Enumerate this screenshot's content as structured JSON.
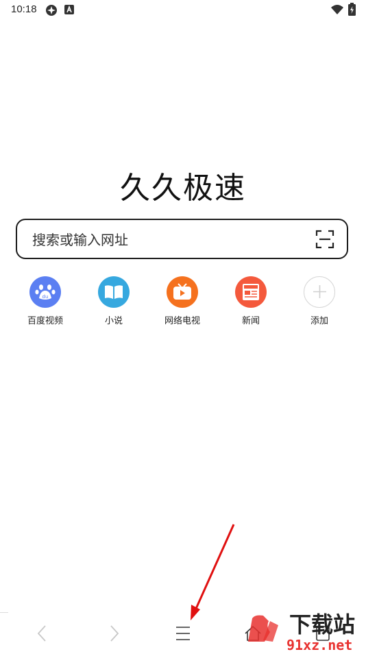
{
  "status_bar": {
    "time": "10:18"
  },
  "app": {
    "title": "久久极速"
  },
  "search": {
    "placeholder": "搜索或输入网址"
  },
  "shortcuts": [
    {
      "label": "百度视频",
      "icon": "baidu-paw-icon",
      "color": "#5b7ff2"
    },
    {
      "label": "小说",
      "icon": "book-icon",
      "color": "#36a8df"
    },
    {
      "label": "网络电视",
      "icon": "tv-icon",
      "color": "#f5711e"
    },
    {
      "label": "新闻",
      "icon": "news-icon",
      "color": "#f4593c"
    },
    {
      "label": "添加",
      "icon": "plus-icon",
      "color": "#cccccc"
    }
  ],
  "watermark": {
    "brand": "下载站",
    "site": "91xz.net"
  }
}
